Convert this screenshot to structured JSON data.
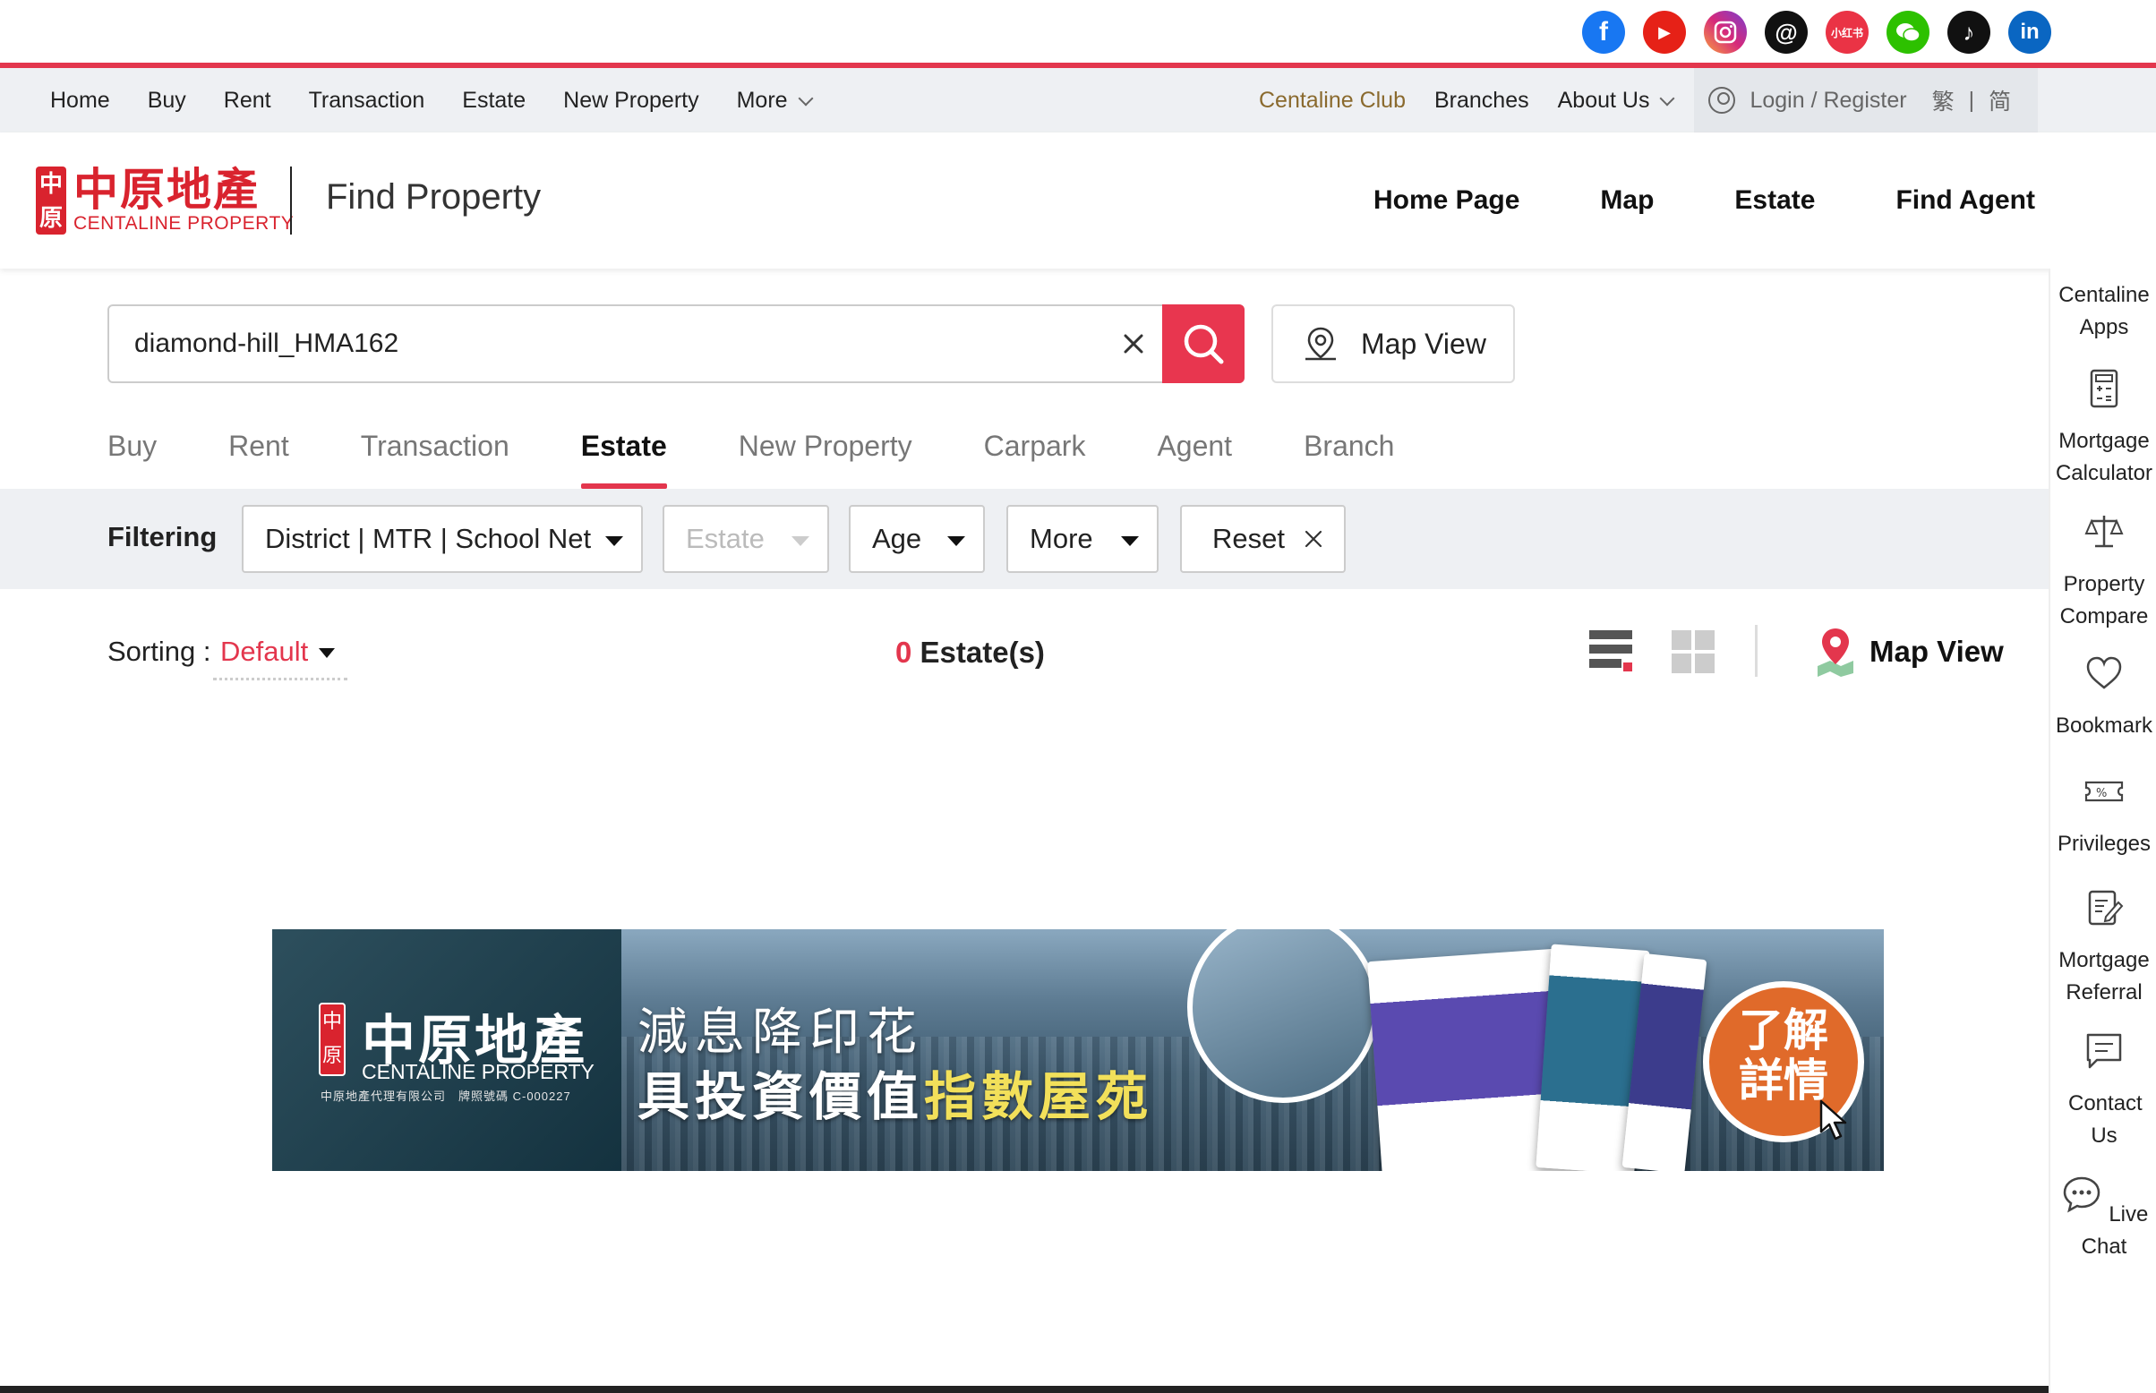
{
  "social": {
    "icons": [
      {
        "name": "facebook-icon",
        "color": "#1877f2",
        "glyph": "f"
      },
      {
        "name": "youtube-icon",
        "color": "#e62117",
        "glyph": "▶"
      },
      {
        "name": "instagram-icon",
        "color": "#d6297a",
        "glyph": "◎"
      },
      {
        "name": "threads-icon",
        "color": "#111111",
        "glyph": "@"
      },
      {
        "name": "xiaohongshu-icon",
        "color": "#ea3345",
        "glyph": "小红书"
      },
      {
        "name": "wechat-icon",
        "color": "#2dc100",
        "glyph": "✆"
      },
      {
        "name": "tiktok-icon",
        "color": "#111111",
        "glyph": "♪"
      },
      {
        "name": "linkedin-icon",
        "color": "#0a66c2",
        "glyph": "in"
      }
    ]
  },
  "top_nav": {
    "left": [
      "Home",
      "Buy",
      "Rent",
      "Transaction",
      "Estate",
      "New Property",
      "More"
    ],
    "club": "Centaline Club",
    "branches": "Branches",
    "about": "About Us",
    "login": "Login / Register",
    "lang_trad": "繁",
    "lang_sep": "|",
    "lang_simp": "简"
  },
  "header": {
    "logo_cn": "中原地產",
    "logo_en": "CENTALINE PROPERTY",
    "title": "Find Property",
    "nav": [
      "Home Page",
      "Map",
      "Estate",
      "Find Agent"
    ]
  },
  "search": {
    "value": "diamond-hill_HMA162",
    "map_view": "Map View"
  },
  "tabs": {
    "items": [
      "Buy",
      "Rent",
      "Transaction",
      "Estate",
      "New Property",
      "Carpark",
      "Agent",
      "Branch"
    ],
    "active": "Estate"
  },
  "filter": {
    "label": "Filtering",
    "district": "District | MTR | School Net",
    "estate": "Estate",
    "age": "Age",
    "more": "More",
    "reset": "Reset"
  },
  "results": {
    "sort_label": "Sorting :",
    "sort_value": "Default",
    "count": "0",
    "count_label": "Estate(s)",
    "map_view": "Map View"
  },
  "banner": {
    "seal": "中原",
    "brand_cn": "中原地產",
    "brand_en": "CENTALINE PROPERTY",
    "license": "中原地產代理有限公司　牌照號碼 C-000227",
    "line1": "減息降印花",
    "line2_a": "具投資價值",
    "line2_b": "指數屋苑",
    "cta_1": "了解",
    "cta_2": "詳情"
  },
  "sidebar": [
    {
      "label": "Centaline Apps",
      "icon": "apps-icon"
    },
    {
      "label": "Mortgage Calculator",
      "icon": "calculator-icon"
    },
    {
      "label": "Property Compare",
      "icon": "scale-icon"
    },
    {
      "label": "Bookmark",
      "icon": "heart-icon"
    },
    {
      "label": "Privileges",
      "icon": "ticket-icon"
    },
    {
      "label": "Mortgage Referral",
      "icon": "document-edit-icon"
    },
    {
      "label": "Contact Us",
      "icon": "message-icon"
    },
    {
      "label": "Live Chat",
      "icon": "chat-bubble-icon"
    }
  ],
  "colors": {
    "accent": "#e3364d",
    "brand_red": "#d9232e",
    "club_gold": "#8a6a2e",
    "nav_bg": "#eef0f3"
  }
}
